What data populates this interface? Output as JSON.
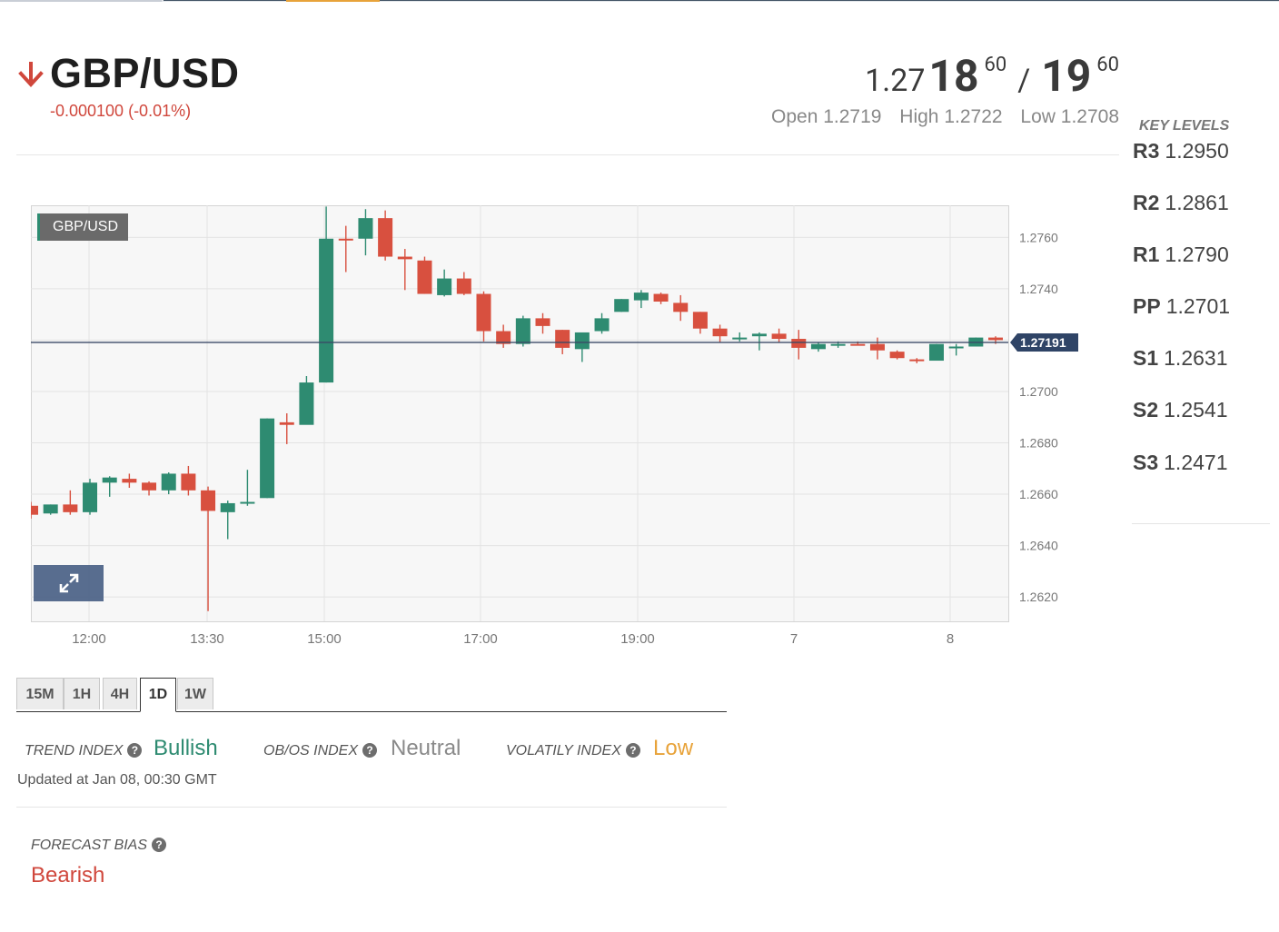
{
  "header": {
    "pair": "GBP/USD",
    "direction_icon": "arrow-down-icon",
    "change": "-0.000100 (-0.01%)",
    "bid_small": "1.27",
    "bid_big": "18",
    "bid_sup": "60",
    "separator": "/",
    "ask_big": "19",
    "ask_sup": "60",
    "open": "Open 1.2719",
    "high": "High 1.2722",
    "low": "Low 1.2708",
    "down_color": "#d0473c"
  },
  "chart": {
    "label": "GBP/USD",
    "expand_icon": "expand-arrows-icon",
    "current_price_label": "1.27191"
  },
  "chart_data": {
    "type": "candlestick",
    "xlabels": [
      "12:00",
      "13:30",
      "15:00",
      "17:00",
      "19:00",
      "7",
      "8"
    ],
    "ylabels": [
      "1.2760",
      "1.2740",
      "1.2720",
      "1.2700",
      "1.2680",
      "1.2660",
      "1.2640",
      "1.2620"
    ],
    "ylim": [
      1.26105,
      1.27725
    ],
    "current_price": 1.27191,
    "up_color": "#2e8b71",
    "down_color": "#d8503f",
    "candles": [
      {
        "o": 1.26555,
        "h": 1.2657,
        "l": 1.26505,
        "c": 1.2652
      },
      {
        "o": 1.26525,
        "h": 1.2656,
        "l": 1.2652,
        "c": 1.2656
      },
      {
        "o": 1.2656,
        "h": 1.26615,
        "l": 1.2652,
        "c": 1.2653
      },
      {
        "o": 1.2653,
        "h": 1.2666,
        "l": 1.2652,
        "c": 1.26645
      },
      {
        "o": 1.26645,
        "h": 1.2667,
        "l": 1.2659,
        "c": 1.26665
      },
      {
        "o": 1.2666,
        "h": 1.2668,
        "l": 1.26625,
        "c": 1.26645
      },
      {
        "o": 1.26645,
        "h": 1.2665,
        "l": 1.26595,
        "c": 1.26615
      },
      {
        "o": 1.26615,
        "h": 1.26685,
        "l": 1.266,
        "c": 1.2668
      },
      {
        "o": 1.2668,
        "h": 1.2671,
        "l": 1.26595,
        "c": 1.26615
      },
      {
        "o": 1.26615,
        "h": 1.2663,
        "l": 1.26145,
        "c": 1.26535
      },
      {
        "o": 1.2653,
        "h": 1.26575,
        "l": 1.26425,
        "c": 1.26565
      },
      {
        "o": 1.26565,
        "h": 1.26695,
        "l": 1.26555,
        "c": 1.2657
      },
      {
        "o": 1.26585,
        "h": 1.26895,
        "l": 1.26585,
        "c": 1.26895
      },
      {
        "o": 1.2688,
        "h": 1.26915,
        "l": 1.26795,
        "c": 1.2687
      },
      {
        "o": 1.2687,
        "h": 1.2706,
        "l": 1.26875,
        "c": 1.27035
      },
      {
        "o": 1.27035,
        "h": 1.2772,
        "l": 1.27035,
        "c": 1.27595
      },
      {
        "o": 1.27595,
        "h": 1.27645,
        "l": 1.27465,
        "c": 1.2759
      },
      {
        "o": 1.27595,
        "h": 1.2771,
        "l": 1.2753,
        "c": 1.27675
      },
      {
        "o": 1.27675,
        "h": 1.27705,
        "l": 1.2751,
        "c": 1.27525
      },
      {
        "o": 1.27525,
        "h": 1.27555,
        "l": 1.27395,
        "c": 1.27515
      },
      {
        "o": 1.2751,
        "h": 1.27525,
        "l": 1.2738,
        "c": 1.2738
      },
      {
        "o": 1.27375,
        "h": 1.27475,
        "l": 1.2737,
        "c": 1.2744
      },
      {
        "o": 1.2744,
        "h": 1.27465,
        "l": 1.27375,
        "c": 1.2738
      },
      {
        "o": 1.2738,
        "h": 1.2739,
        "l": 1.27195,
        "c": 1.27235
      },
      {
        "o": 1.27235,
        "h": 1.2726,
        "l": 1.2717,
        "c": 1.27185
      },
      {
        "o": 1.27185,
        "h": 1.27295,
        "l": 1.27175,
        "c": 1.27285
      },
      {
        "o": 1.27285,
        "h": 1.27305,
        "l": 1.27225,
        "c": 1.27255
      },
      {
        "o": 1.2724,
        "h": 1.2724,
        "l": 1.27145,
        "c": 1.2717
      },
      {
        "o": 1.27165,
        "h": 1.27225,
        "l": 1.27115,
        "c": 1.2723
      },
      {
        "o": 1.27235,
        "h": 1.27305,
        "l": 1.27225,
        "c": 1.27285
      },
      {
        "o": 1.2731,
        "h": 1.2736,
        "l": 1.2731,
        "c": 1.2736
      },
      {
        "o": 1.27355,
        "h": 1.27395,
        "l": 1.27325,
        "c": 1.27385
      },
      {
        "o": 1.2738,
        "h": 1.27385,
        "l": 1.2734,
        "c": 1.2735
      },
      {
        "o": 1.27345,
        "h": 1.27375,
        "l": 1.27275,
        "c": 1.2731
      },
      {
        "o": 1.2731,
        "h": 1.2731,
        "l": 1.27225,
        "c": 1.27245
      },
      {
        "o": 1.27245,
        "h": 1.2726,
        "l": 1.2719,
        "c": 1.27215
      },
      {
        "o": 1.27205,
        "h": 1.2723,
        "l": 1.27195,
        "c": 1.2721
      },
      {
        "o": 1.27215,
        "h": 1.2723,
        "l": 1.2716,
        "c": 1.27225
      },
      {
        "o": 1.27225,
        "h": 1.27245,
        "l": 1.2719,
        "c": 1.27205
      },
      {
        "o": 1.27205,
        "h": 1.2724,
        "l": 1.27125,
        "c": 1.2717
      },
      {
        "o": 1.27165,
        "h": 1.2719,
        "l": 1.27155,
        "c": 1.27185
      },
      {
        "o": 1.27185,
        "h": 1.27195,
        "l": 1.2717,
        "c": 1.27185
      },
      {
        "o": 1.27185,
        "h": 1.27195,
        "l": 1.2718,
        "c": 1.2718
      },
      {
        "o": 1.27185,
        "h": 1.2721,
        "l": 1.27125,
        "c": 1.2716
      },
      {
        "o": 1.27155,
        "h": 1.2716,
        "l": 1.27125,
        "c": 1.2713
      },
      {
        "o": 1.27125,
        "h": 1.2713,
        "l": 1.2711,
        "c": 1.2712
      },
      {
        "o": 1.2712,
        "h": 1.27185,
        "l": 1.27125,
        "c": 1.27185
      },
      {
        "o": 1.27175,
        "h": 1.27185,
        "l": 1.2714,
        "c": 1.27175
      },
      {
        "o": 1.27175,
        "h": 1.2721,
        "l": 1.27175,
        "c": 1.2721
      },
      {
        "o": 1.2721,
        "h": 1.27215,
        "l": 1.27185,
        "c": 1.272
      }
    ]
  },
  "timeframes": {
    "items": [
      "15M",
      "1H",
      "4H",
      "1D",
      "1W"
    ],
    "active": "1D"
  },
  "indices": {
    "trend_label": "TREND INDEX",
    "trend_value": "Bullish",
    "trend_color": "#2e8b71",
    "obos_label": "OB/OS INDEX",
    "obos_value": "Neutral",
    "obos_color": "#8a8a8a",
    "volatility_label": "VOLATILY INDEX",
    "volatility_value": "Low",
    "volatility_color": "#e8a33a",
    "help_icon": "question-circle-icon",
    "help_glyph": "?",
    "updated": "Updated at Jan 08, 00:30 GMT"
  },
  "forecast": {
    "label": "FORECAST BIAS",
    "value": "Bearish"
  },
  "key_levels": {
    "title": "KEY LEVELS",
    "items": [
      {
        "name": "R3",
        "value": "1.2950"
      },
      {
        "name": "R2",
        "value": "1.2861"
      },
      {
        "name": "R1",
        "value": "1.2790"
      },
      {
        "name": "PP",
        "value": "1.2701"
      },
      {
        "name": "S1",
        "value": "1.2631"
      },
      {
        "name": "S2",
        "value": "1.2541"
      },
      {
        "name": "S3",
        "value": "1.2471"
      }
    ]
  }
}
